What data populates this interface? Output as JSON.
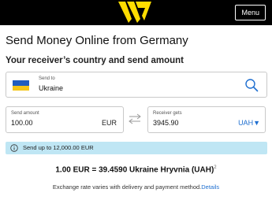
{
  "header": {
    "menu_label": "Menu",
    "bg_color": "#000000",
    "logo_color": "#ffdd00",
    "logo_icon": "wu-logo-icon"
  },
  "page": {
    "title": "Send Money Online from Germany",
    "section_title": "Your receiver’s country and send amount"
  },
  "country": {
    "label": "Send to",
    "value": "Ukraine",
    "flag_icon": "ukraine-flag-icon",
    "search_icon": "search-icon"
  },
  "send": {
    "label": "Send amount",
    "value": "100.00",
    "currency": "EUR"
  },
  "receive": {
    "label": "Receiver gets",
    "value": "3945.90",
    "currency": "UAH",
    "dropdown_icon": "caret-down-icon"
  },
  "info": {
    "text": "Send up to 12,000.00 EUR",
    "icon": "info-icon",
    "bg_color": "#bfe6f4"
  },
  "rate": {
    "text": "1.00 EUR = 39.4590 Ukraine Hryvnia (UAH)",
    "footnote": "2"
  },
  "note": {
    "text": "Exchange rate varies with delivery and payment method.",
    "link": "Details"
  },
  "colors": {
    "accent": "#1f6fd0"
  }
}
